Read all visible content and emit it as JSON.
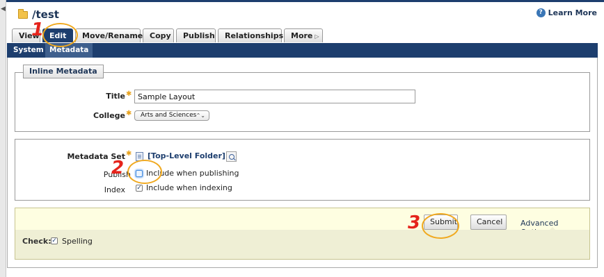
{
  "page": {
    "title": "/test",
    "learn_more": "Learn More"
  },
  "tabs": [
    {
      "label": "View",
      "active": false
    },
    {
      "label": "Edit",
      "active": true
    },
    {
      "label": "Move/Rename",
      "active": false
    },
    {
      "label": "Copy",
      "active": false
    },
    {
      "label": "Publish",
      "active": false
    },
    {
      "label": "Relationships",
      "active": false
    },
    {
      "label": "More",
      "active": false
    }
  ],
  "subtabs": [
    {
      "label": "System",
      "active": false
    },
    {
      "label": "Metadata",
      "active": true
    }
  ],
  "inline_metadata": {
    "legend": "Inline Metadata",
    "title_label": "Title",
    "title_value": "Sample Layout",
    "college_label": "College",
    "college_value": "Arts and Sciences"
  },
  "metadata_set": {
    "label": "Metadata Set",
    "value": "[Top-Level Folder]",
    "publish_label": "Publish",
    "publish_option": "Include when publishing",
    "publish_checked": false,
    "index_label": "Index",
    "index_option": "Include when indexing",
    "index_checked": true
  },
  "actions": {
    "submit": "Submit",
    "cancel": "Cancel",
    "advanced": "Advanced Options",
    "check_label": "Check:",
    "spelling_label": "Spelling",
    "spelling_checked": true
  },
  "callouts": [
    "1",
    "2",
    "3"
  ],
  "colors": {
    "navy": "#1d3e6e",
    "required_star": "#e8a21c",
    "callout_ring": "#f0a91f",
    "callout_number": "#e5231b",
    "action_bar": "#fefee1"
  }
}
